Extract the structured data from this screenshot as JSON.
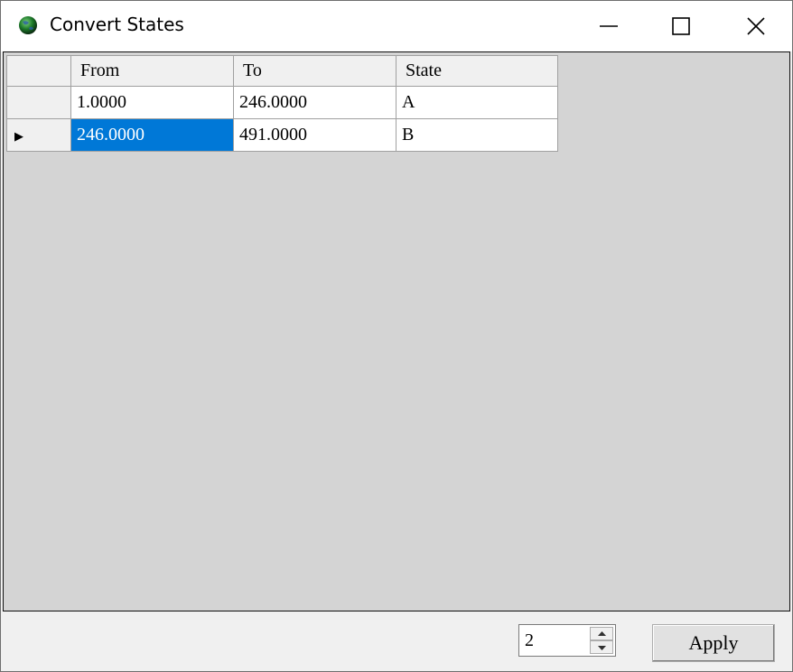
{
  "window": {
    "title": "Convert States"
  },
  "titlebar_buttons": {
    "minimize_icon": "minimize-icon",
    "maximize_icon": "maximize-icon",
    "close_icon": "close-icon"
  },
  "grid": {
    "columns": [
      "From",
      "To",
      "State"
    ],
    "rows": [
      {
        "from": "1.0000",
        "to": "246.0000",
        "state": "A",
        "current": false
      },
      {
        "from": "246.0000",
        "to": "491.0000",
        "state": "B",
        "current": true
      }
    ],
    "current_row_indicator": "▶",
    "colors": {
      "selection": "#0078d7",
      "background": "#d4d4d4"
    }
  },
  "footer": {
    "count_value": "2",
    "apply_label": "Apply"
  }
}
